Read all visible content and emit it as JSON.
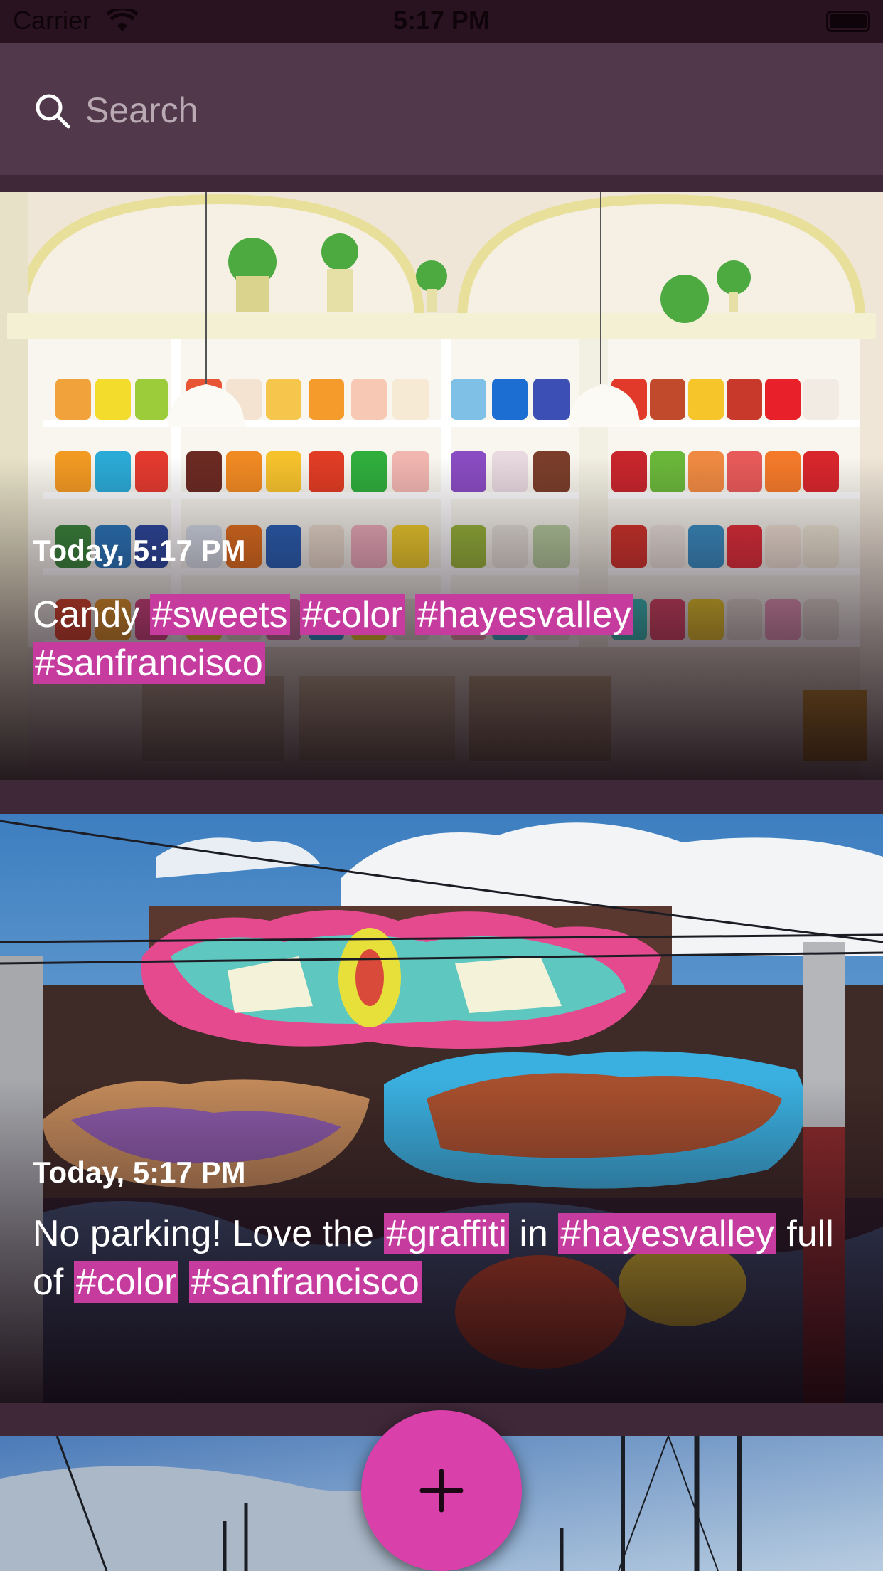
{
  "status_bar": {
    "carrier": "Carrier",
    "time": "5:17 PM"
  },
  "search": {
    "placeholder": "Search",
    "value": ""
  },
  "posts": [
    {
      "time": "Today, 5:17 PM",
      "caption_text": "Candy",
      "tags": [
        "#sweets",
        "#color",
        "#hayesvalley",
        "#sanfrancisco"
      ],
      "image_subject": "candy-shop-shelves"
    },
    {
      "time": "Today, 5:17 PM",
      "caption_parts": [
        "No parking! Love the",
        "#graffiti",
        "in",
        "#hayesvalley",
        "full of",
        "#color",
        "#sanfrancisco"
      ],
      "image_subject": "graffiti-wall"
    },
    {
      "image_subject": "harbor-masts"
    }
  ],
  "fab": {
    "icon": "plus-icon"
  },
  "colors": {
    "background": "#3f2838",
    "search_bar": "#51384a",
    "tag_highlight": "#c53c9e",
    "fab": "#d940aa"
  }
}
